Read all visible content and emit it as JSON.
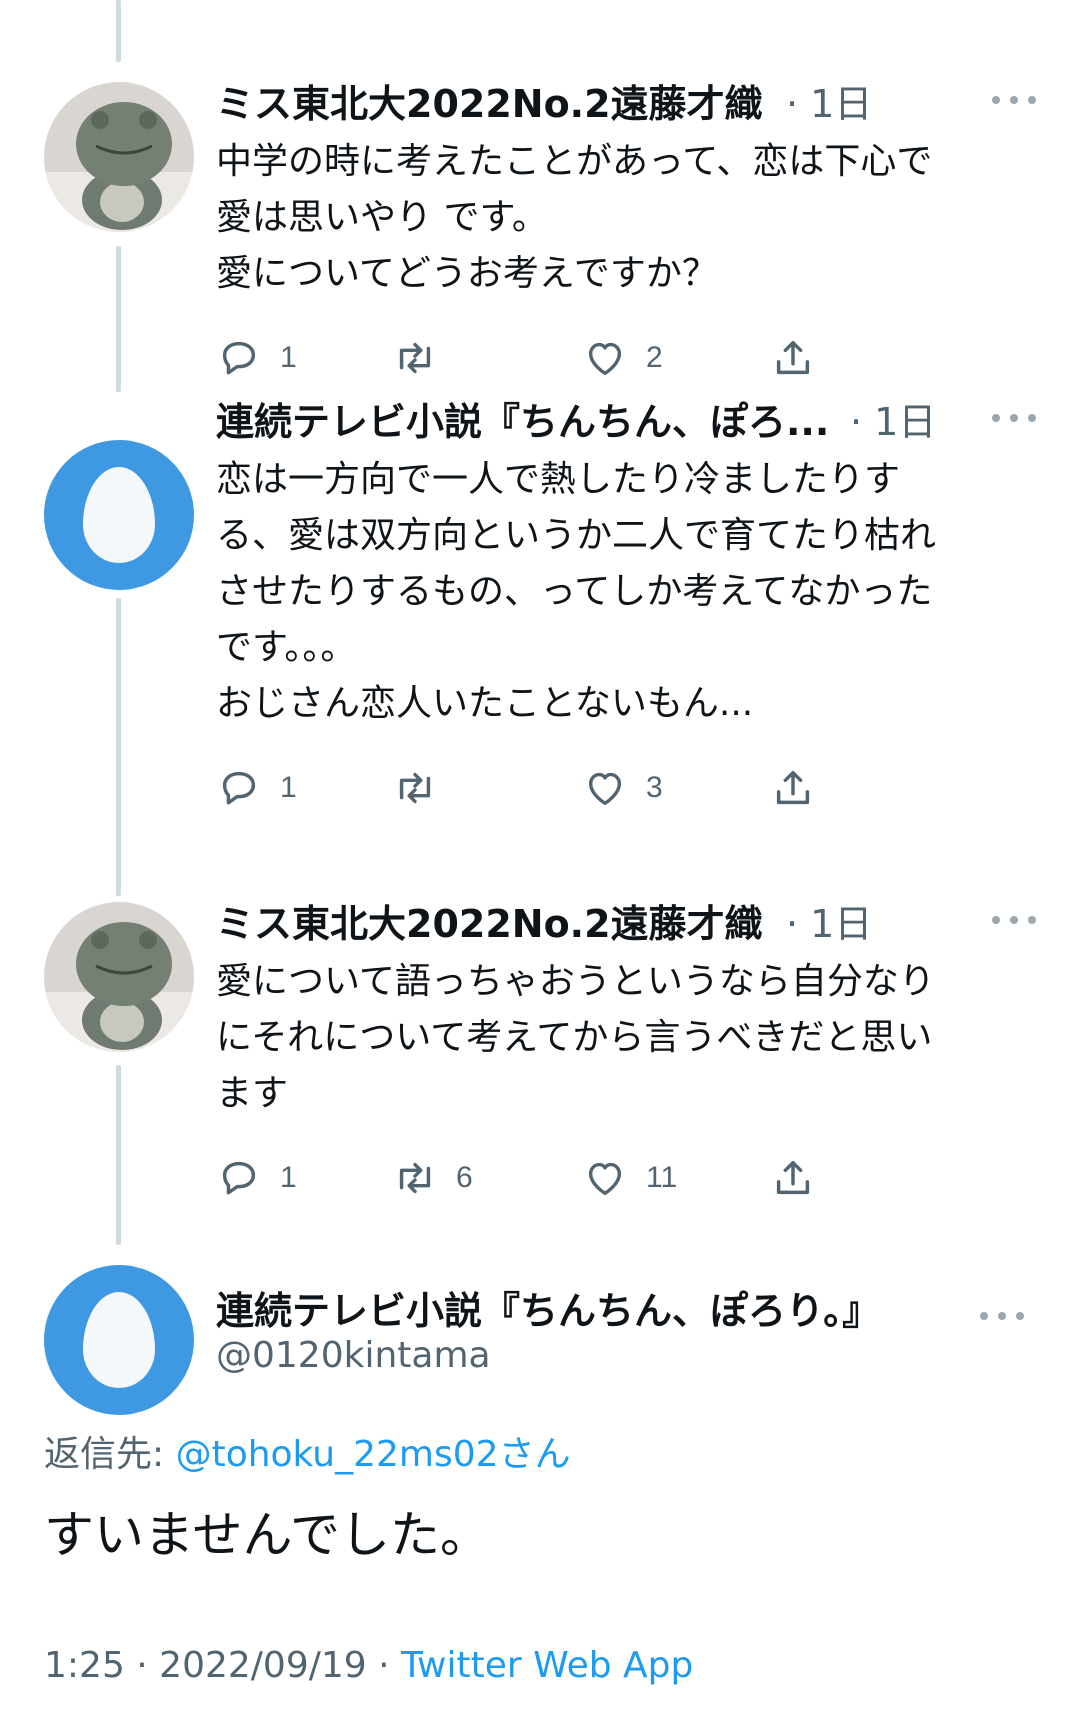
{
  "tweets": [
    {
      "name": "ミス東北大2022No.2遠藤才織",
      "meta": "· 1日",
      "text": "中学の時に考えたことがあって、恋は下心で\n愛は思いやり です。\n愛についてどうお考えですか？",
      "avatar": "frog-plush-photo",
      "replies": "1",
      "retweets": "",
      "likes": "2"
    },
    {
      "name": "連続テレビ小説『ちんちん、ぽろ...",
      "meta": "· 1日",
      "text": "恋は一方向で一人で熱したり冷ましたりす\nる、愛は双方向というか二人で育てたり枯れ\nさせたりするもの、ってしか考えてなかった\nです。。。\nおじさん恋人いたことないもん...",
      "avatar": "default-egg",
      "replies": "1",
      "retweets": "",
      "likes": "3"
    },
    {
      "name": "ミス東北大2022No.2遠藤才織",
      "meta": "· 1日",
      "text": "愛について語っちゃおうというなら自分なり\nにそれについて考えてから言うべきだと思い\nます",
      "avatar": "frog-plush-photo",
      "replies": "1",
      "retweets": "6",
      "likes": "11"
    }
  ],
  "main_tweet": {
    "name": "連続テレビ小説『ちんちん、ぽろり。』",
    "handle": "@0120kintama",
    "reply_prefix": "返信先: ",
    "reply_mention": "@tohoku_22ms02",
    "reply_suffix": "さん",
    "text": "すいませんでした。",
    "time": "1:25 · 2022/09/19 · ",
    "client": "Twitter Web App"
  },
  "colors": {
    "accent": "#1d9bf0",
    "secondary_text": "#536471",
    "thread_line": "#cfd9de",
    "egg_avatar_bg": "#3f98e2"
  },
  "icons": [
    "reply-icon",
    "retweet-icon",
    "like-icon",
    "share-icon",
    "more-icon"
  ]
}
